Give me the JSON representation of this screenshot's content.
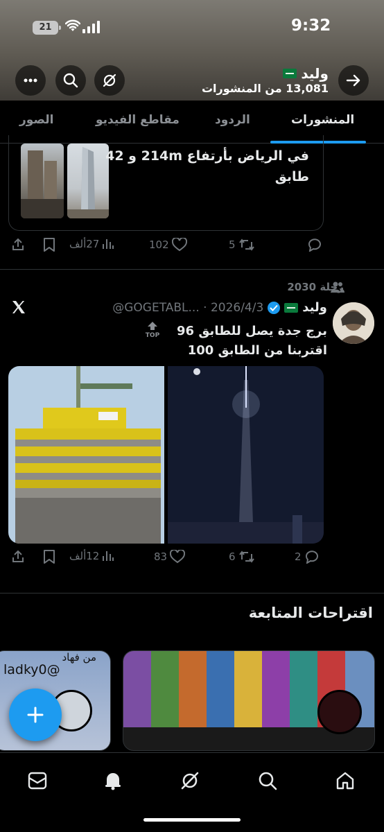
{
  "status_bar": {
    "time": "9:32",
    "battery": "21"
  },
  "header": {
    "name": "وليد",
    "post_count": "13,081 من المنشورات"
  },
  "tabs": [
    {
      "label": "المنشورات",
      "active": true
    },
    {
      "label": "الردود",
      "active": false
    },
    {
      "label": "مقاطع الفيديو",
      "active": false
    },
    {
      "label": "الصور",
      "active": false
    }
  ],
  "post1": {
    "title_line1": "في الرياض بأرتفاع 214m و 42",
    "title_line2": "طابق",
    "replies": "",
    "reposts": "5",
    "likes": "102",
    "views": "27ألف"
  },
  "post2": {
    "repost_label": "رحلة 2030",
    "name": "وليد",
    "handle_date": "@GOGETABL... · 2026/4/3",
    "top_badge": "TOP",
    "text_line1": "برج جدة يصل للطابق 96",
    "text_line2": "اقتربنا من الطابق 100",
    "replies": "2",
    "reposts": "6",
    "likes": "83",
    "views": "12ألف"
  },
  "suggestions": {
    "title": "اقتراحات المتابعة",
    "card_left_text_1": "من فهاد",
    "card_left_text_2": "ladky0@"
  },
  "colors": {
    "accent": "#1d9bf0",
    "background": "#000000",
    "muted": "#71767b"
  }
}
